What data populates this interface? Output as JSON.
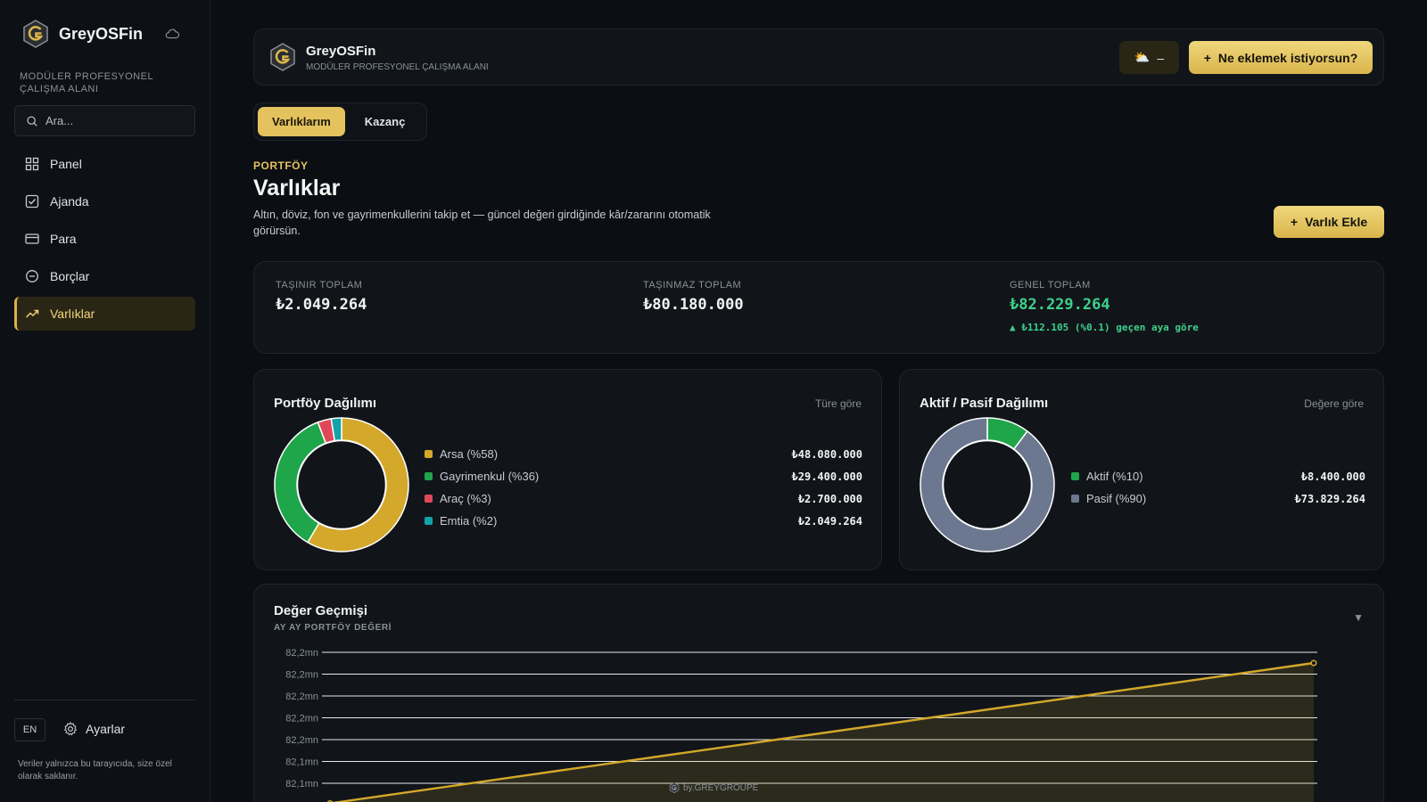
{
  "sidebar": {
    "brand": "GreyOSFin",
    "subtitle": "MODÜLER PROFESYONEL ÇALIŞMA ALANI",
    "search_placeholder": "Ara...",
    "items": [
      {
        "label": "Panel",
        "icon": "grid-icon"
      },
      {
        "label": "Ajanda",
        "icon": "checkbox-icon"
      },
      {
        "label": "Para",
        "icon": "card-icon"
      },
      {
        "label": "Borçlar",
        "icon": "circle-icon"
      },
      {
        "label": "Varlıklar",
        "icon": "trending-up-icon",
        "active": true
      }
    ],
    "lang": "EN",
    "settings_label": "Ayarlar",
    "footer": "Veriler yalnızca bu tarayıcıda, size özel olarak saklanır."
  },
  "header": {
    "title": "GreyOSFin",
    "subtitle": "MODÜLER PROFESYONEL ÇALIŞMA ALANI",
    "weather_icon": "⛅",
    "weather_value": "–",
    "cta_label": "Ne eklemek istiyorsun?"
  },
  "tabs": [
    "Varlıklarım",
    "Kazanç"
  ],
  "page": {
    "eyebrow": "PORTFÖY",
    "title": "Varlıklar",
    "description": "Altın, döviz, fon ve gayrimenkullerini takip et — güncel değeri girdiğinde kâr/zararını otomatik görürsün.",
    "add_label": "Varlık Ekle"
  },
  "totals": {
    "movable_label": "TAŞINIR TOPLAM",
    "movable_value": "₺2.049.264",
    "immovable_label": "TAŞINMAZ TOPLAM",
    "immovable_value": "₺80.180.000",
    "grand_label": "GENEL TOPLAM",
    "grand_value": "₺82.229.264",
    "change": "▲ ₺112.105 (%0.1) geçen aya göre"
  },
  "portfolio_card": {
    "title": "Portföy Dağılımı",
    "hint": "Türe göre"
  },
  "active_card": {
    "title": "Aktif / Pasif Dağılımı",
    "hint": "Değere göre"
  },
  "history": {
    "title": "Değer Geçmişi",
    "subtitle": "AY AY PORTFÖY DEĞERİ",
    "watermark": "by.GREYGROUPE"
  },
  "colors": {
    "gold": "#d4a82a",
    "green": "#1fa64b",
    "red": "#e0485a",
    "teal": "#14a3a8",
    "slate": "#6b7890"
  },
  "chart_data": [
    {
      "type": "pie",
      "categories": [
        "Arsa (%58)",
        "Gayrimenkul (%36)",
        "Araç (%3)",
        "Emtia (%2)"
      ],
      "values": [
        48080000,
        29400000,
        2700000,
        2049264
      ],
      "labels": [
        "₺48.080.000",
        "₺29.400.000",
        "₺2.700.000",
        "₺2.049.264"
      ],
      "colors": [
        "#d4a82a",
        "#1fa64b",
        "#e0485a",
        "#14a3a8"
      ]
    },
    {
      "type": "pie",
      "categories": [
        "Aktif (%10)",
        "Pasif (%90)"
      ],
      "values": [
        8400000,
        73829264
      ],
      "labels": [
        "₺8.400.000",
        "₺73.829.264"
      ],
      "colors": [
        "#1fa64b",
        "#6b7890"
      ]
    },
    {
      "type": "area",
      "title": "Değer Geçmişi",
      "y_tick_labels": [
        "82,2mn",
        "82,2mn",
        "82,2mn",
        "82,2mn",
        "82,2mn",
        "82,1mn",
        "82,1mn",
        "82,1mn"
      ],
      "ylim": [
        82117159,
        82229264
      ],
      "values": [
        82117159,
        82229264
      ],
      "grid": true
    }
  ]
}
